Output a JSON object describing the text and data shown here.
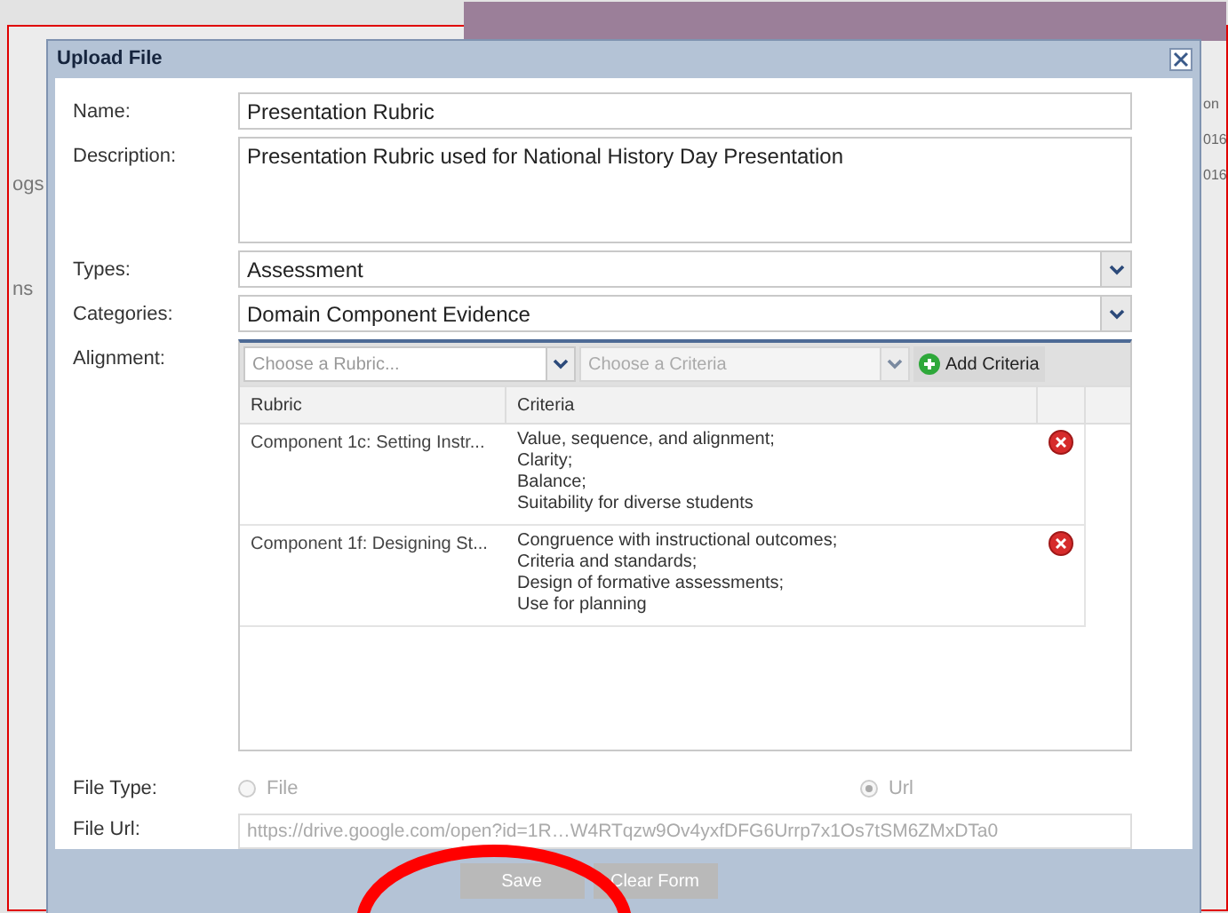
{
  "background": {
    "sidebar_items": [
      "ogs",
      "ns"
    ],
    "right_cells": [
      "on",
      "016",
      "016"
    ]
  },
  "dialog": {
    "title": "Upload File",
    "fields": [
      {
        "label": "Name:",
        "kind": "text",
        "value": "Presentation Rubric"
      },
      {
        "label": "Description:",
        "kind": "textarea",
        "value": "Presentation Rubric used for National History Day Presentation"
      },
      {
        "label": "Types:",
        "kind": "select",
        "value": "Assessment"
      },
      {
        "label": "Categories:",
        "kind": "select",
        "value": "Domain Component Evidence"
      }
    ],
    "alignment": {
      "label": "Alignment:",
      "rubric_placeholder": "Choose a Rubric...",
      "criteria_placeholder": "Choose a Criteria",
      "add_button": "Add Criteria",
      "columns": [
        "Rubric",
        "Criteria"
      ],
      "rows": [
        {
          "rubric": "Component 1c: Setting Instr...",
          "criteria": [
            "Value, sequence, and alignment;",
            "Clarity;",
            "Balance;",
            "Suitability for diverse students"
          ]
        },
        {
          "rubric": "Component 1f: Designing St...",
          "criteria": [
            "Congruence with instructional outcomes;",
            "Criteria and standards;",
            "Design of formative assessments;",
            "Use for planning"
          ]
        }
      ]
    },
    "file_type": {
      "label": "File Type:",
      "options": [
        {
          "label": "File",
          "selected": false
        },
        {
          "label": "Url",
          "selected": true
        }
      ]
    },
    "file_url": {
      "label": "File Url:",
      "value": "https://drive.google.com/open?id=1R…W4RTqzw9Ov4yxfDFG6Urrp7x1Os7tSM6ZMxDTa0"
    },
    "buttons": [
      "Save",
      "Clear Form"
    ]
  }
}
